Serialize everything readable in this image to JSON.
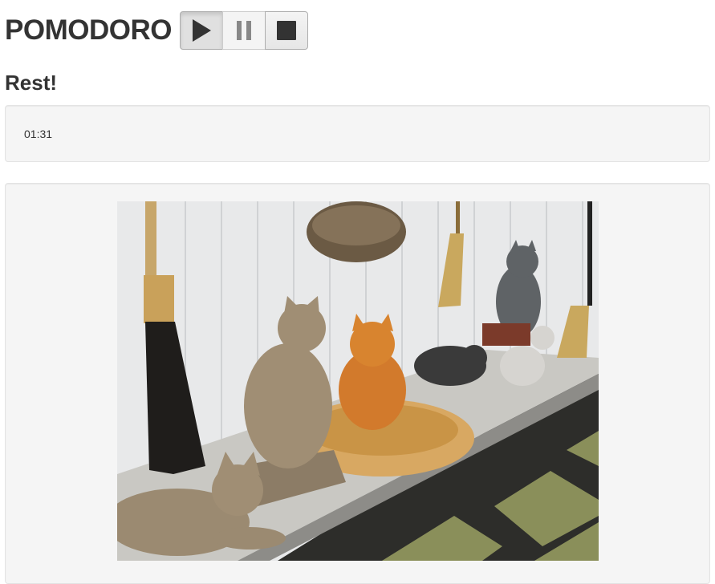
{
  "app": {
    "title": "POMODORO"
  },
  "controls": [
    {
      "name": "play-button",
      "icon": "play-icon",
      "state": "active"
    },
    {
      "name": "pause-button",
      "icon": "pause-icon",
      "state": "disabled"
    },
    {
      "name": "stop-button",
      "icon": "stop-icon",
      "state": "normal"
    }
  ],
  "status": {
    "text": "Rest!"
  },
  "timer": {
    "value": "01:31"
  },
  "image": {
    "alt": "cat statues and an orange cat on a bench"
  },
  "colors": {
    "well_bg": "#f5f5f5",
    "text": "#333333",
    "icon": "#333333"
  }
}
